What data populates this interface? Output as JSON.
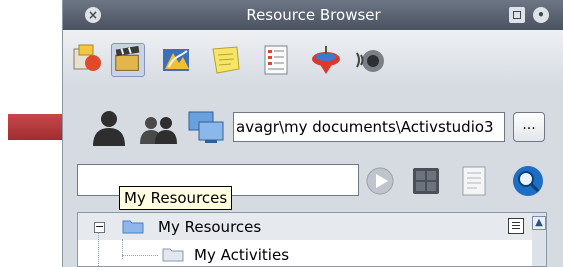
{
  "window": {
    "title": "Resource Browser"
  },
  "toolbar": {
    "tools": [
      {
        "icon": "shapes-icon"
      },
      {
        "icon": "film-clapper-icon"
      },
      {
        "icon": "background-image-icon"
      },
      {
        "icon": "sticky-note-icon"
      },
      {
        "icon": "document-list-icon"
      },
      {
        "icon": "spinning-top-icon"
      },
      {
        "icon": "speaker-icon"
      }
    ]
  },
  "source": {
    "path_value": "avagr\\my documents\\Activstudio3",
    "browse_label": "..."
  },
  "tooltip": {
    "text": "My Resources"
  },
  "tree": {
    "root_label": "My Resources",
    "child_label": "My Activities",
    "expander": "−"
  },
  "colors": {
    "titlebar": "#4a5260",
    "panel": "#d6dbe2",
    "arrow": "#c0383a",
    "tooltip_bg": "#ffffe1"
  }
}
